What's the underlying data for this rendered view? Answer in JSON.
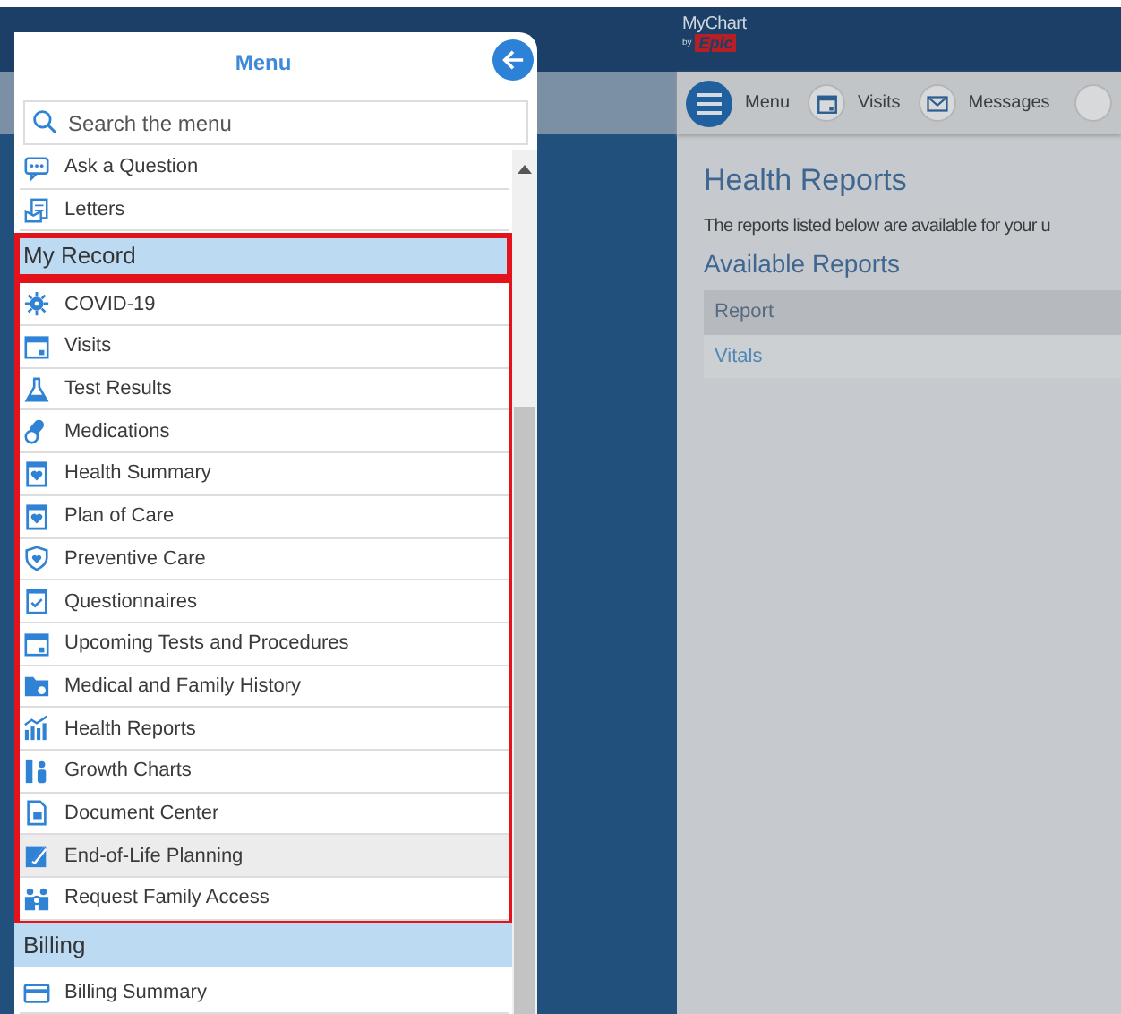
{
  "background_page": {
    "logo": {
      "name": "MyChart",
      "byline": "by",
      "brand": "Epic"
    },
    "toolbar": [
      {
        "label": "Menu",
        "kind": "menu"
      },
      {
        "label": "Visits",
        "kind": "round"
      },
      {
        "label": "Messages",
        "kind": "round"
      },
      {
        "kind": "partial"
      }
    ],
    "heading": "Health Reports",
    "intro": "The reports listed below are available for your u",
    "subheading": "Available Reports",
    "table": {
      "columns": [
        "Report"
      ],
      "rows": [
        [
          "Vitals"
        ]
      ]
    }
  },
  "menu": {
    "title": "Menu",
    "search": {
      "placeholder": "Search the menu"
    },
    "sections": [
      {
        "highlighted": false,
        "items": [
          {
            "label": "Ask a Question",
            "hovered": false
          },
          {
            "label": "Letters",
            "hovered": false
          }
        ]
      },
      {
        "title": "My Record",
        "highlighted": true,
        "items": [
          {
            "label": "COVID-19",
            "hovered": false
          },
          {
            "label": "Visits",
            "hovered": false
          },
          {
            "label": "Test Results",
            "hovered": false
          },
          {
            "label": "Medications",
            "hovered": false
          },
          {
            "label": "Health Summary",
            "hovered": false
          },
          {
            "label": "Plan of Care",
            "hovered": false
          },
          {
            "label": "Preventive Care",
            "hovered": false
          },
          {
            "label": "Questionnaires",
            "hovered": false
          },
          {
            "label": "Upcoming Tests and Procedures",
            "hovered": false
          },
          {
            "label": "Medical and Family History",
            "hovered": false
          },
          {
            "label": "Health Reports",
            "hovered": false
          },
          {
            "label": "Growth Charts",
            "hovered": false
          },
          {
            "label": "Document Center",
            "hovered": false
          },
          {
            "label": "End-of-Life Planning",
            "hovered": true
          },
          {
            "label": "Request Family Access",
            "hovered": false
          }
        ]
      },
      {
        "title": "Billing",
        "highlighted": false,
        "items": [
          {
            "label": "Billing Summary",
            "hovered": false
          }
        ]
      }
    ]
  }
}
